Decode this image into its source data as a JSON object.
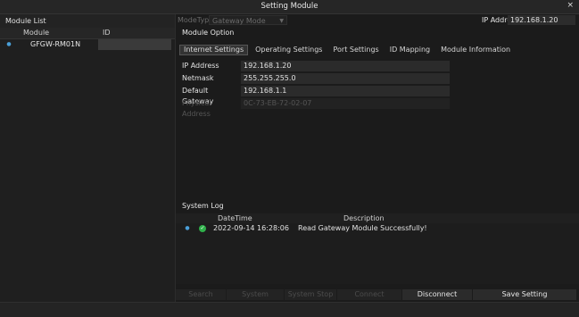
{
  "window": {
    "title": "Setting Module",
    "close_glyph": "×"
  },
  "module_list": {
    "heading": "Module List",
    "columns": [
      "Module",
      "ID"
    ],
    "rows": [
      {
        "name": "GFGW-RM01N",
        "id": ""
      }
    ]
  },
  "mode": {
    "label": "ModeType",
    "value": "Gateway Mode"
  },
  "ip_address": {
    "label": "IP Address",
    "value": "192.168.1.20"
  },
  "module_option": {
    "heading": "Module Option",
    "tabs": [
      "Internet Settings",
      "Operating Settings",
      "Port Settings",
      "ID Mapping",
      "Module Information"
    ],
    "active_tab": "Internet Settings"
  },
  "internet_settings": {
    "ip_label": "IP Address",
    "ip_value": "192.168.1.20",
    "netmask_label": "Netmask",
    "netmask_value": "255.255.255.0",
    "gateway_label": "Default Gateway",
    "gateway_value": "192.168.1.1",
    "physical_label": "Physical Address",
    "physical_value": "0C-73-EB-72-02-07"
  },
  "system_log": {
    "heading": "System Log",
    "columns": [
      "DateTime",
      "Description"
    ],
    "entries": [
      {
        "datetime": "2022-09-14 16:28:06",
        "description": "Read Gateway Module Successfully!"
      }
    ]
  },
  "buttons": {
    "search": "Search",
    "system_running": "System Running",
    "system_stop": "System Stop",
    "connect": "Connect",
    "disconnect": "Disconnect",
    "save_setting": "Save Setting"
  },
  "colors": {
    "background": "#1b1b1b",
    "accent_blue": "#4a9fd8",
    "success_green": "#2fb04a"
  }
}
